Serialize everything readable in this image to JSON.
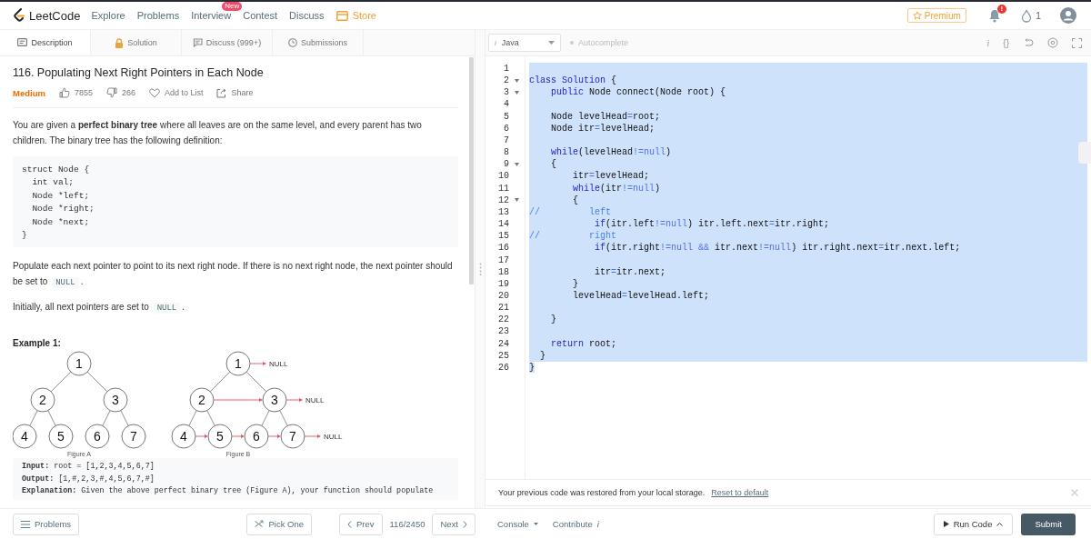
{
  "nav": {
    "brand": "LeetCode",
    "links": [
      {
        "label": "Explore",
        "kind": "link"
      },
      {
        "label": "Problems",
        "kind": "link"
      },
      {
        "label": "Interview",
        "kind": "link",
        "badge": "New"
      },
      {
        "label": "Contest",
        "kind": "link"
      },
      {
        "label": "Discuss",
        "kind": "link"
      },
      {
        "label": "Store",
        "kind": "store"
      }
    ],
    "premium": "Premium",
    "notification_badge": "!",
    "streak_count": "1"
  },
  "tabs": [
    {
      "label": "Description",
      "selected": true
    },
    {
      "label": "Solution",
      "selected": false
    },
    {
      "label": "Discuss (999+)",
      "selected": false
    },
    {
      "label": "Submissions",
      "selected": false
    }
  ],
  "problem": {
    "title": "116. Populating Next Right Pointers in Each Node",
    "difficulty": "Medium",
    "likes": "7855",
    "dislikes": "266",
    "add_to_list": "Add to List",
    "share": "Share",
    "intro": "You are given a **perfect binary tree** where all leaves are on the same level, and every parent has two children. The binary tree has the following definition:",
    "definition": [
      "struct Node {",
      "  int val;",
      "  Node *left;",
      "  Node *right;",
      "  Node *next;",
      "}"
    ],
    "paragraphs": [
      [
        {
          "text": "Populate each next pointer to point to its next right node. If there is no next right node, the next pointer should be set to ",
          "kind": "text"
        },
        {
          "text": "NULL",
          "kind": "code"
        },
        {
          "text": ".",
          "kind": "text"
        }
      ],
      [
        {
          "text": "Initially, all next pointers are set to ",
          "kind": "text"
        },
        {
          "text": "NULL",
          "kind": "code"
        },
        {
          "text": ".",
          "kind": "text"
        }
      ]
    ],
    "example_heading": "Example 1:",
    "figures": [
      {
        "caption": "Figure A",
        "nodes": [
          "1",
          "2",
          "3",
          "4",
          "5",
          "6",
          "7"
        ],
        "next_pointers": false
      },
      {
        "caption": "Figure B",
        "nodes": [
          "1",
          "2",
          "3",
          "4",
          "5",
          "6",
          "7"
        ],
        "next_pointers": true,
        "null_labels": [
          "NULL",
          "NULL",
          "NULL"
        ]
      }
    ],
    "example_lines": [
      "**Input:** root = [1,2,3,4,5,6,7]",
      "**Output:** [1,#,2,3,#,4,5,6,7,#]",
      "**Explanation:** Given the above perfect binary tree (Figure A), your function should populate"
    ]
  },
  "editor": {
    "language_prefix": "i",
    "language": "Java",
    "autocomplete": {
      "label": "Autocomplete",
      "on": false
    },
    "tool_glyphs": [
      "i",
      "{}"
    ],
    "lines": [
      {
        "number": "1",
        "fold": false,
        "selected": true
      },
      {
        "number": "2",
        "fold": true,
        "selected": true,
        "tokens": [
          {
            "text": "class",
            "kind": "keyword"
          },
          {
            "text": " Solution",
            "kind": "keyword"
          },
          {
            "text": " {",
            "kind": "plain"
          }
        ]
      },
      {
        "number": "3",
        "fold": true,
        "selected": true,
        "tokens": [
          {
            "text": "    public",
            "kind": "keyword"
          },
          {
            "text": " Node connect(Node root) {",
            "kind": "plain"
          }
        ]
      },
      {
        "number": "4",
        "fold": false,
        "selected": true
      },
      {
        "number": "5",
        "fold": false,
        "selected": true,
        "tokens": [
          {
            "text": "    Node levelHead",
            "kind": "plain"
          },
          {
            "text": "=",
            "kind": "operator"
          },
          {
            "text": "root;",
            "kind": "plain"
          }
        ]
      },
      {
        "number": "6",
        "fold": false,
        "selected": true,
        "tokens": [
          {
            "text": "    Node itr",
            "kind": "plain"
          },
          {
            "text": "=",
            "kind": "operator"
          },
          {
            "text": "levelHead;",
            "kind": "plain"
          }
        ]
      },
      {
        "number": "7",
        "fold": false,
        "selected": true
      },
      {
        "number": "8",
        "fold": false,
        "selected": true,
        "tokens": [
          {
            "text": "    while",
            "kind": "keyword"
          },
          {
            "text": "(levelHead",
            "kind": "plain"
          },
          {
            "text": "!=",
            "kind": "operator"
          },
          {
            "text": "null",
            "kind": "operator"
          },
          {
            "text": ")",
            "kind": "plain"
          }
        ]
      },
      {
        "number": "9",
        "fold": true,
        "selected": true,
        "tokens": [
          {
            "text": "    {",
            "kind": "plain"
          }
        ]
      },
      {
        "number": "10",
        "fold": false,
        "selected": true,
        "tokens": [
          {
            "text": "        itr",
            "kind": "plain"
          },
          {
            "text": "=",
            "kind": "operator"
          },
          {
            "text": "levelHead;",
            "kind": "plain"
          }
        ]
      },
      {
        "number": "11",
        "fold": false,
        "selected": true,
        "tokens": [
          {
            "text": "        while",
            "kind": "keyword"
          },
          {
            "text": "(itr",
            "kind": "plain"
          },
          {
            "text": "!=",
            "kind": "operator"
          },
          {
            "text": "null",
            "kind": "operator"
          },
          {
            "text": ")",
            "kind": "plain"
          }
        ]
      },
      {
        "number": "12",
        "fold": true,
        "selected": true,
        "tokens": [
          {
            "text": "        {",
            "kind": "plain"
          }
        ]
      },
      {
        "number": "13",
        "fold": false,
        "selected": true,
        "tokens": [
          {
            "text": "//         left",
            "kind": "comment"
          }
        ]
      },
      {
        "number": "14",
        "fold": false,
        "selected": true,
        "tokens": [
          {
            "text": "            if",
            "kind": "keyword"
          },
          {
            "text": "(itr.left",
            "kind": "plain"
          },
          {
            "text": "!=",
            "kind": "operator"
          },
          {
            "text": "null",
            "kind": "operator"
          },
          {
            "text": ") itr.left.next",
            "kind": "plain"
          },
          {
            "text": "=",
            "kind": "operator"
          },
          {
            "text": "itr.right;",
            "kind": "plain"
          }
        ]
      },
      {
        "number": "15",
        "fold": false,
        "selected": true,
        "tokens": [
          {
            "text": "//         right",
            "kind": "comment"
          }
        ]
      },
      {
        "number": "16",
        "fold": false,
        "selected": true,
        "tokens": [
          {
            "text": "            if",
            "kind": "keyword"
          },
          {
            "text": "(itr.right",
            "kind": "plain"
          },
          {
            "text": "!=",
            "kind": "operator"
          },
          {
            "text": "null",
            "kind": "operator"
          },
          {
            "text": " &&",
            "kind": "operator"
          },
          {
            "text": " itr.next",
            "kind": "plain"
          },
          {
            "text": "!=",
            "kind": "operator"
          },
          {
            "text": "null",
            "kind": "operator"
          },
          {
            "text": ") itr.right.next",
            "kind": "plain"
          },
          {
            "text": "=",
            "kind": "operator"
          },
          {
            "text": "itr.next.left;",
            "kind": "plain"
          }
        ]
      },
      {
        "number": "17",
        "fold": false,
        "selected": true
      },
      {
        "number": "18",
        "fold": false,
        "selected": true,
        "tokens": [
          {
            "text": "            itr",
            "kind": "plain"
          },
          {
            "text": "=",
            "kind": "operator"
          },
          {
            "text": "itr.next;",
            "kind": "plain"
          }
        ]
      },
      {
        "number": "19",
        "fold": false,
        "selected": true,
        "tokens": [
          {
            "text": "        }",
            "kind": "plain"
          }
        ]
      },
      {
        "number": "20",
        "fold": false,
        "selected": true,
        "tokens": [
          {
            "text": "        levelHead",
            "kind": "plain"
          },
          {
            "text": "=",
            "kind": "operator"
          },
          {
            "text": "levelHead.left;",
            "kind": "plain"
          }
        ]
      },
      {
        "number": "21",
        "fold": false,
        "selected": true
      },
      {
        "number": "22",
        "fold": false,
        "selected": true,
        "tokens": [
          {
            "text": "    }",
            "kind": "plain"
          }
        ]
      },
      {
        "number": "23",
        "fold": false,
        "selected": true
      },
      {
        "number": "24",
        "fold": false,
        "selected": true,
        "tokens": [
          {
            "text": "    return",
            "kind": "keyword"
          },
          {
            "text": " root;",
            "kind": "plain"
          }
        ]
      },
      {
        "number": "25",
        "fold": false,
        "selected": true,
        "tokens": [
          {
            "text": "  }",
            "kind": "plain"
          }
        ]
      },
      {
        "number": "26",
        "fold": false,
        "selected": true,
        "tokens": [
          {
            "text": "}",
            "kind": "plain"
          }
        ]
      }
    ]
  },
  "notice": {
    "message": "Your previous code was restored from your local storage.",
    "link": "Reset to default"
  },
  "footer": {
    "problems": "Problems",
    "pick_one": "Pick One",
    "prev": "Prev",
    "position": "116/2450",
    "next": "Next",
    "console": "Console",
    "contribute": "Contribute *i*",
    "run_code": "Run Code",
    "submit": "Submit"
  }
}
